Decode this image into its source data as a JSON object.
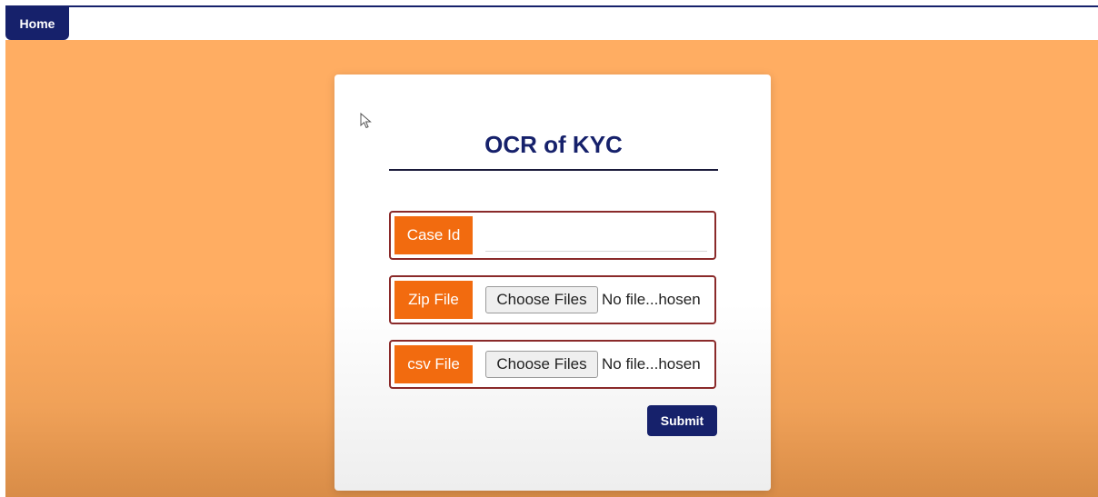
{
  "nav": {
    "home_label": "Home"
  },
  "form": {
    "title": "OCR of KYC",
    "case_id": {
      "label": "Case Id",
      "value": ""
    },
    "zip_file": {
      "label": "Zip File",
      "button_label": "Choose Files",
      "status": "No file...hosen"
    },
    "csv_file": {
      "label": "csv File",
      "button_label": "Choose Files",
      "status": "No file...hosen"
    },
    "submit_label": "Submit"
  },
  "icons": {
    "cursor": "mouse-pointer-icon"
  },
  "colors": {
    "brand_navy": "#16216b",
    "accent_orange": "#f26b0f",
    "background_orange": "#ffad62",
    "field_border": "#8a2a2a"
  }
}
